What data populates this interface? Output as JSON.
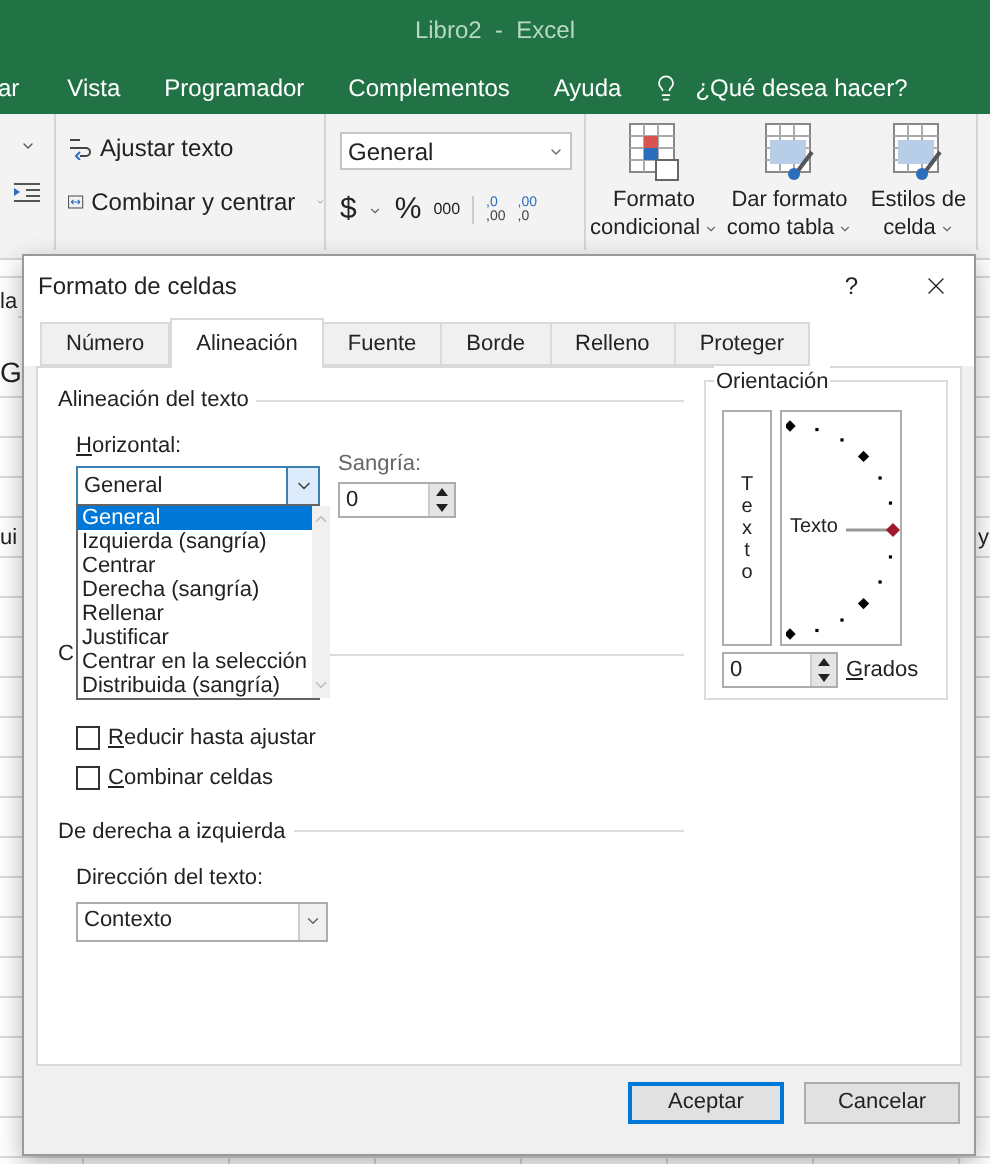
{
  "window": {
    "title": "Libro2  -  Excel"
  },
  "menu_tabs": [
    "ar",
    "Vista",
    "Programador",
    "Complementos",
    "Ayuda"
  ],
  "tell_me": "¿Qué desea hacer?",
  "ribbon": {
    "wrap_text": "Ajustar texto",
    "merge": "Combinar y centrar",
    "number_format": "General",
    "currency": "$",
    "percent": "%",
    "thousands": "000",
    "decimal_buttons": [
      {
        "top": ",0",
        "bottom": ",00"
      },
      {
        "top": ",00",
        "bottom": ",0"
      }
    ],
    "styles": [
      {
        "line1": "Formato",
        "line2": "condicional"
      },
      {
        "line1": "Dar formato",
        "line2": "como tabla"
      },
      {
        "line1": "Estilos de",
        "line2": "celda"
      }
    ]
  },
  "sheet_fragments": [
    "la",
    "G",
    "ui",
    "y"
  ],
  "dialog": {
    "title": "Formato de celdas",
    "help": "?",
    "tabs": [
      {
        "label": "Número",
        "selected": false
      },
      {
        "label": "Alineación",
        "selected": true
      },
      {
        "label": "Fuente",
        "selected": false
      },
      {
        "label": "Borde",
        "selected": false
      },
      {
        "label": "Relleno",
        "selected": false
      },
      {
        "label": "Proteger",
        "selected": false
      }
    ],
    "alignment": {
      "heading": "Alineación del texto",
      "horizontal_label": "Horizontal:",
      "horizontal_value": "General",
      "indent_label": "Sangría:",
      "indent_value": "0",
      "options": [
        {
          "label": "General",
          "selected": true
        },
        {
          "label": "Izquierda (sangría)",
          "selected": false
        },
        {
          "label": "Centrar",
          "selected": false
        },
        {
          "label": "Derecha (sangría)",
          "selected": false
        },
        {
          "label": "Rellenar",
          "selected": false
        },
        {
          "label": "Justificar",
          "selected": false
        },
        {
          "label": "Centrar en la selección",
          "selected": false
        },
        {
          "label": "Distribuida (sangría)",
          "selected": false
        }
      ]
    },
    "control": {
      "heading": "C",
      "checkboxes": [
        {
          "label": "Reducir hasta ajustar",
          "checked": false
        },
        {
          "label": "Combinar celdas",
          "checked": false
        }
      ]
    },
    "rtl": {
      "heading": "De derecha a izquierda",
      "direction_label": "Dirección del texto:",
      "direction_value": "Contexto"
    },
    "orientation": {
      "heading": "Orientación",
      "vertical_text": "Texto",
      "dial_label": "Texto",
      "degrees_value": "0",
      "degrees_label": "Grados"
    },
    "buttons": [
      {
        "label": "Aceptar",
        "default": true
      },
      {
        "label": "Cancelar",
        "default": false
      }
    ]
  }
}
